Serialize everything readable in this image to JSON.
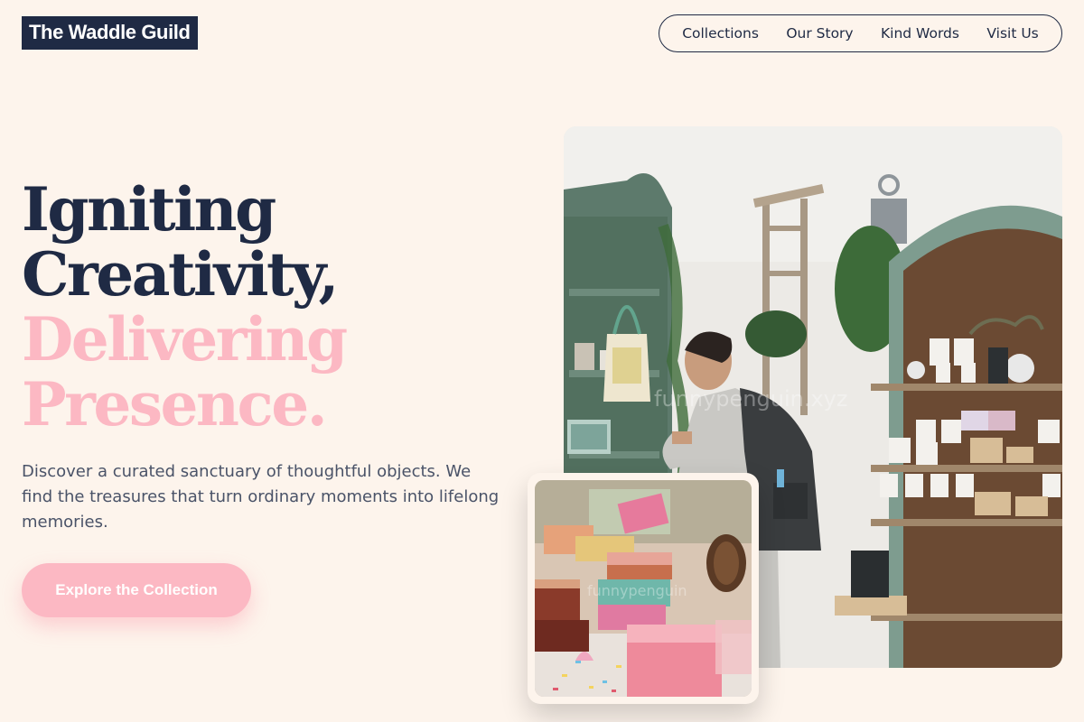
{
  "brand": {
    "name": "The Waddle Guild"
  },
  "nav": {
    "items": [
      "Collections",
      "Our Story",
      "Kind Words",
      "Visit Us"
    ]
  },
  "hero": {
    "headline_dark": [
      "Igniting",
      "Creativity,"
    ],
    "headline_pink": [
      "Delivering",
      "Presence."
    ],
    "description": "Discover a curated sanctuary of thoughtful objects. We find the treasures that turn ordinary moments into lifelong memories.",
    "cta_label": "Explore the Collection"
  },
  "images": {
    "main_photo": {
      "alt": "Shopper browsing shelves in a gift shop",
      "watermark": "funnypenguin.xyz"
    },
    "inset_photo": {
      "alt": "Colorful soap bars and pine cone on a table",
      "watermark": "funnypenguin"
    }
  },
  "colors": {
    "background": "#fdf4ec",
    "navy": "#1f2a44",
    "pink": "#fcb8c3",
    "body_text": "#4a5368"
  }
}
